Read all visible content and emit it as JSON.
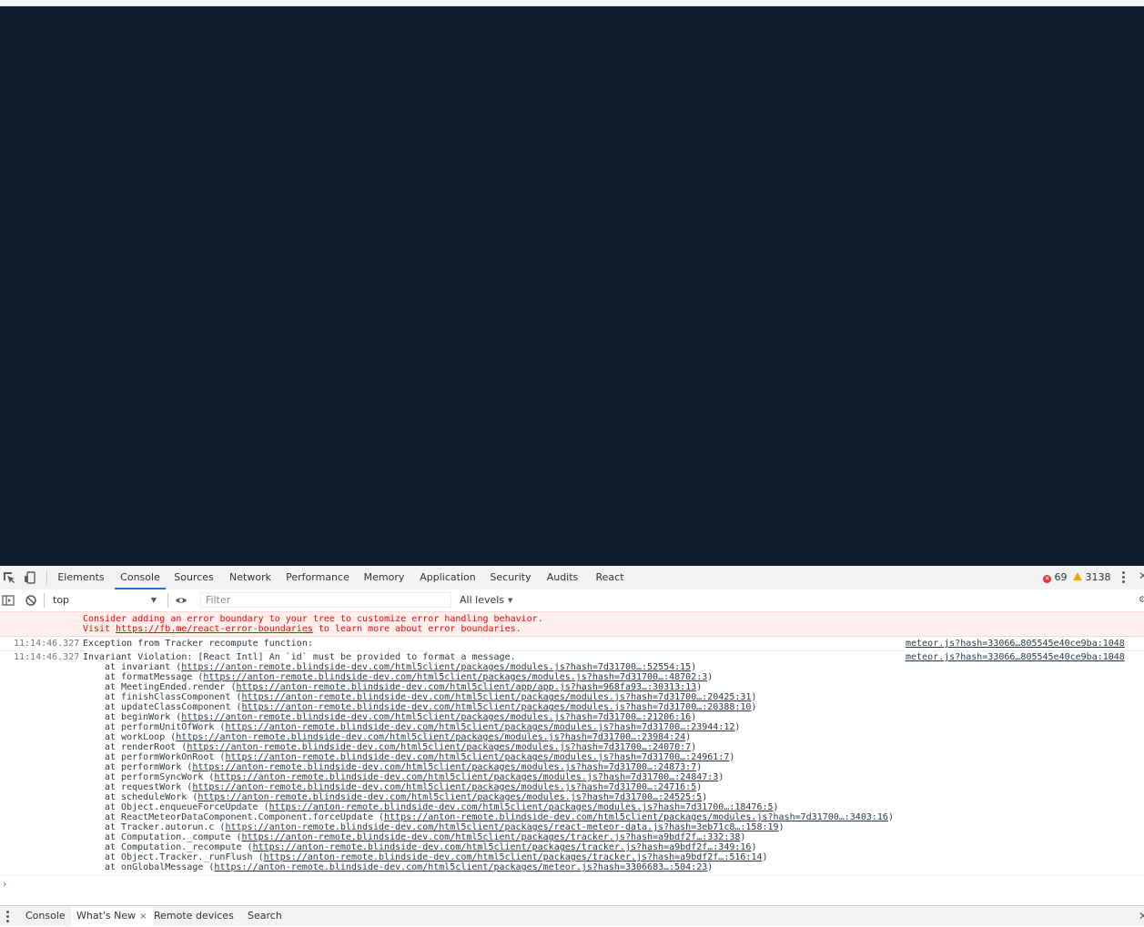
{
  "devtools": {
    "tabs": [
      "Elements",
      "Console",
      "Sources",
      "Network",
      "Performance",
      "Memory",
      "Application",
      "Security",
      "Audits",
      "React"
    ],
    "active_tab": "Console",
    "error_count": "69",
    "warning_count": "3138"
  },
  "console_toolbar": {
    "context": "top",
    "filter_placeholder": "Filter",
    "levels": "All levels"
  },
  "messages": {
    "error_box": [
      "Consider adding an error boundary to your tree to customize error handling behavior.",
      "Visit https://fb.me/react-error-boundaries to learn more about error boundaries."
    ],
    "log1": {
      "time": "11:14:46.327",
      "text": "Exception from Tracker recompute function:",
      "source": "meteor.js?hash=33066…805545e40ce9ba:1048"
    },
    "log2": {
      "time": "11:14:46.327",
      "text": "Invariant Violation: [React Intl] An `id` must be provided to format a message.",
      "source": "meteor.js?hash=33066…805545e40ce9ba:1048",
      "stack": [
        {
          "fn": "at invariant (",
          "url": "https://anton-remote.blindside-dev.com/html5client/packages/modules.js?hash=7d31700…:52554:15",
          "end": ")"
        },
        {
          "fn": "at formatMessage (",
          "url": "https://anton-remote.blindside-dev.com/html5client/packages/modules.js?hash=7d31700…:48702:3",
          "end": ")"
        },
        {
          "fn": "at MeetingEnded.render (",
          "url": "https://anton-remote.blindside-dev.com/html5client/app/app.js?hash=968fa93…:30313:13",
          "end": ")"
        },
        {
          "fn": "at finishClassComponent (",
          "url": "https://anton-remote.blindside-dev.com/html5client/packages/modules.js?hash=7d31700…:20425:31",
          "end": ")"
        },
        {
          "fn": "at updateClassComponent (",
          "url": "https://anton-remote.blindside-dev.com/html5client/packages/modules.js?hash=7d31700…:20388:10",
          "end": ")"
        },
        {
          "fn": "at beginWork (",
          "url": "https://anton-remote.blindside-dev.com/html5client/packages/modules.js?hash=7d31700…:21206:16",
          "end": ")"
        },
        {
          "fn": "at performUnitOfWork (",
          "url": "https://anton-remote.blindside-dev.com/html5client/packages/modules.js?hash=7d31700…:23944:12",
          "end": ")"
        },
        {
          "fn": "at workLoop (",
          "url": "https://anton-remote.blindside-dev.com/html5client/packages/modules.js?hash=7d31700…:23984:24",
          "end": ")"
        },
        {
          "fn": "at renderRoot (",
          "url": "https://anton-remote.blindside-dev.com/html5client/packages/modules.js?hash=7d31700…:24070:7",
          "end": ")"
        },
        {
          "fn": "at performWorkOnRoot (",
          "url": "https://anton-remote.blindside-dev.com/html5client/packages/modules.js?hash=7d31700…:24961:7",
          "end": ")"
        },
        {
          "fn": "at performWork (",
          "url": "https://anton-remote.blindside-dev.com/html5client/packages/modules.js?hash=7d31700…:24873:7",
          "end": ")"
        },
        {
          "fn": "at performSyncWork (",
          "url": "https://anton-remote.blindside-dev.com/html5client/packages/modules.js?hash=7d31700…:24847:3",
          "end": ")"
        },
        {
          "fn": "at requestWork (",
          "url": "https://anton-remote.blindside-dev.com/html5client/packages/modules.js?hash=7d31700…:24716:5",
          "end": ")"
        },
        {
          "fn": "at scheduleWork (",
          "url": "https://anton-remote.blindside-dev.com/html5client/packages/modules.js?hash=7d31700…:24525:5",
          "end": ")"
        },
        {
          "fn": "at Object.enqueueForceUpdate (",
          "url": "https://anton-remote.blindside-dev.com/html5client/packages/modules.js?hash=7d31700…:18476:5",
          "end": ")"
        },
        {
          "fn": "at ReactMeteorDataComponent.Component.forceUpdate (",
          "url": "https://anton-remote.blindside-dev.com/html5client/packages/modules.js?hash=7d31700…:3403:16",
          "end": ")"
        },
        {
          "fn": "at Tracker.autorun.c (",
          "url": "https://anton-remote.blindside-dev.com/html5client/packages/react-meteor-data.js?hash=3eb71c8…:158:19",
          "end": ")"
        },
        {
          "fn": "at Computation._compute (",
          "url": "https://anton-remote.blindside-dev.com/html5client/packages/tracker.js?hash=a9bdf2f…:332:38",
          "end": ")"
        },
        {
          "fn": "at Computation._recompute (",
          "url": "https://anton-remote.blindside-dev.com/html5client/packages/tracker.js?hash=a9bdf2f…:349:16",
          "end": ")"
        },
        {
          "fn": "at Object.Tracker._runFlush (",
          "url": "https://anton-remote.blindside-dev.com/html5client/packages/tracker.js?hash=a9bdf2f…:516:14",
          "end": ")"
        },
        {
          "fn": "at onGlobalMessage (",
          "url": "https://anton-remote.blindside-dev.com/html5client/packages/meteor.js?hash=3306683…:504:23",
          "end": ")"
        }
      ]
    }
  },
  "drawer": {
    "tabs": [
      "Console",
      "What's New",
      "Remote devices",
      "Search"
    ],
    "active_tab": "What's New",
    "close_glyph": "×"
  },
  "prompt_glyph": "›"
}
